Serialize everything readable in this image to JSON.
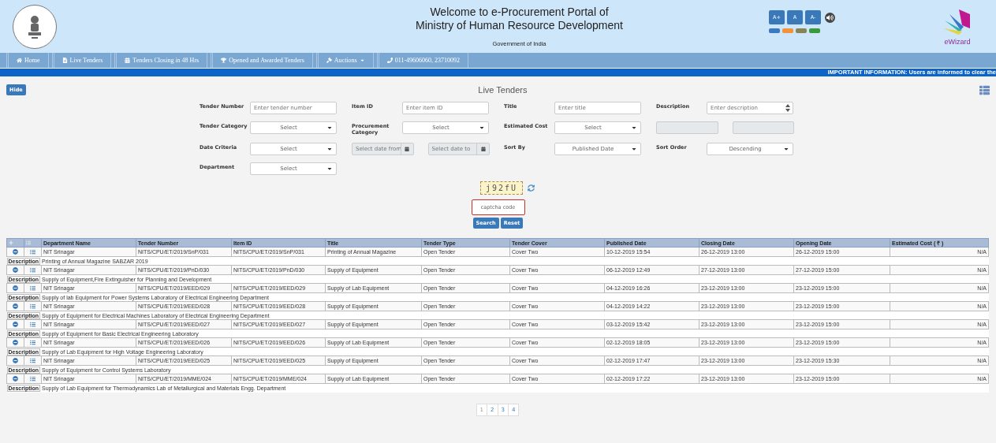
{
  "header": {
    "title_lines": [
      "Welcome to e-Procurement Portal of",
      "Ministry of Human Resource Development"
    ],
    "subtitle": "Government of India",
    "font_buttons": [
      "A+",
      "A",
      "A-"
    ],
    "theme_swatches": [
      {
        "color": "#3b7ac0"
      },
      {
        "color": "#f0933b"
      },
      {
        "color": "#878558"
      },
      {
        "color": "#3b9a3b"
      }
    ],
    "logo_text": "eWizard"
  },
  "nav": {
    "items": [
      {
        "label": "Home",
        "dropdown": false
      },
      {
        "label": "Live Tenders",
        "dropdown": false
      },
      {
        "label": "Tenders Closing in 48 Hrs",
        "dropdown": false
      },
      {
        "label": "Opened and Awarded Tenders",
        "dropdown": false
      },
      {
        "label": "Auctions",
        "dropdown": true
      },
      {
        "label": "011-49606060, 23710092",
        "dropdown": false
      }
    ]
  },
  "ticker": "IMPORTANT INFORMATION: Users are informed to clear the",
  "hide_button": "Hide",
  "page_title": "Live Tenders",
  "filters": [
    [
      {
        "label": "Tender Number",
        "fields": [
          {
            "kind": "text",
            "placeholder": "Enter tender number"
          }
        ]
      },
      {
        "label": "Item ID",
        "fields": [
          {
            "kind": "text",
            "placeholder": "Enter item ID"
          }
        ]
      },
      {
        "label": "Title",
        "fields": [
          {
            "kind": "text",
            "placeholder": "Enter title"
          }
        ]
      },
      {
        "label": "Description",
        "fields": [
          {
            "kind": "spin",
            "placeholder": "Enter description"
          }
        ]
      }
    ],
    [
      {
        "label": "Tender Category",
        "fields": [
          {
            "kind": "select",
            "value": "Select"
          }
        ]
      },
      {
        "label": "Procurement Category",
        "fields": [
          {
            "kind": "select",
            "value": "Select"
          }
        ]
      },
      {
        "label": "Estimated Cost",
        "fields": [
          {
            "kind": "select",
            "value": "Select"
          }
        ]
      },
      {
        "fields": [
          {
            "kind": "blank"
          },
          {
            "kind": "blank"
          }
        ]
      }
    ],
    [
      {
        "label": "Date Criteria",
        "fields": [
          {
            "kind": "select",
            "value": "Select"
          }
        ]
      },
      {
        "fields": [
          {
            "kind": "date",
            "placeholder": "Select date from"
          },
          {
            "kind": "date",
            "placeholder": "Select date to"
          }
        ]
      },
      {
        "label": "Sort By",
        "fields": [
          {
            "kind": "select",
            "value": "Published Date"
          }
        ]
      },
      {
        "label": "Sort Order",
        "fields": [
          {
            "kind": "select",
            "value": "Descending"
          }
        ]
      }
    ],
    [
      {
        "label": "Department",
        "fields": [
          {
            "kind": "select",
            "value": "Select"
          }
        ]
      }
    ]
  ],
  "captcha": {
    "text": "j92fU",
    "placeholder": "captcha code"
  },
  "form_buttons": [
    "Search",
    "Reset"
  ],
  "table": {
    "columns": [
      "Department Name",
      "Tender Number",
      "Item ID",
      "Title",
      "Tender Type",
      "Tender Cover",
      "Published Date",
      "Closing Date",
      "Opening Date",
      "Estimated Cost ( ₹ )"
    ],
    "rows": [
      {
        "cells": [
          "NIT Srinagar",
          "NITS/CPU/ET/2019/SnP/031",
          "NITS/CPU/ET/2019/SnP/031",
          "Printing of Annual Magazine",
          "Open Tender",
          "Cover Two",
          "10-12-2019 15:54",
          "26-12-2019 13:00",
          "26-12-2019 15:00",
          "N/A"
        ],
        "description_label": "Description",
        "description": "Printing of Annual Magazine SABZAR 2019"
      },
      {
        "cells": [
          "NIT Srinagar",
          "NITS/CPU/ET/2019/PnD/030",
          "NITS/CPU/ET/2019/PnD/030",
          "Supply of Equipment",
          "Open Tender",
          "Cover Two",
          "06-12-2019 12:49",
          "27-12-2019 13:00",
          "27-12-2019 15:00",
          "N/A"
        ],
        "description_label": "Description",
        "description": "Supply of Equipment,Fire Extinguisher for Planning and Development"
      },
      {
        "cells": [
          "NIT Srinagar",
          "NITS/CPU/ET/2019/EED/029",
          "NITS/CPU/ET/2019/EED/029",
          "Supply of Lab Equipment",
          "Open Tender",
          "Cover Two",
          "04-12-2019 16:26",
          "23-12-2019 13:00",
          "23-12-2019 15:00",
          "N/A"
        ],
        "description_label": "Description",
        "description": "Supply of lab Equipment for Power Systems Laboratory of Electrical Engineering Department"
      },
      {
        "cells": [
          "NIT Srinagar",
          "NITS/CPU/ET/2019/EED/028",
          "NITS/CPU/ET/2019/EED/028",
          "Supply of Equipment",
          "Open Tender",
          "Cover Two",
          "04-12-2019 14:22",
          "23-12-2019 13:00",
          "23-12-2019 15:00",
          "N/A"
        ],
        "description_label": "Description",
        "description": "Supply of Equipment for Electrical Machines Laboratory of Electrical Engineering Department"
      },
      {
        "cells": [
          "NIT Srinagar",
          "NITS/CPU/ET/2019/EED/027",
          "NITS/CPU/ET/2019/EED/027",
          "Supply of Equipment",
          "Open Tender",
          "Cover Two",
          "03-12-2019 15:42",
          "23-12-2019 13:00",
          "23-12-2019 15:00",
          "N/A"
        ],
        "description_label": "Description",
        "description": "Supply of Equipment for Basic Electrical Engineering Laboratory"
      },
      {
        "cells": [
          "NIT Srinagar",
          "NITS/CPU/ET/2019/EED/026",
          "NITS/CPU/ET/2019/EED/026",
          "Supply of Lab Equipment",
          "Open Tender",
          "Cover Two",
          "02-12-2019 18:05",
          "23-12-2019 13:00",
          "23-12-2019 15:00",
          "N/A"
        ],
        "description_label": "Description",
        "description": "Supply of Lab Equipment for High Voltage Engineering Laboratory"
      },
      {
        "cells": [
          "NIT Srinagar",
          "NITS/CPU/ET/2019/EED/025",
          "NITS/CPU/ET/2019/EED/025",
          "Supply of Equipment",
          "Open Tender",
          "Cover Two",
          "02-12-2019 17:47",
          "23-12-2019 13:00",
          "23-12-2019 15:30",
          "N/A"
        ],
        "description_label": "Description",
        "description": "Supply of Equipment for Control Systems Laboratory"
      },
      {
        "cells": [
          "NIT Srinagar",
          "NITS/CPU/ET/2019/MME/024",
          "NITS/CPU/ET/2019/MME/024",
          "Supply of Lab Equipment",
          "Open Tender",
          "Cover Two",
          "02-12-2019 17:22",
          "23-12-2019 13:00",
          "23-12-2019 15:00",
          "N/A"
        ],
        "description_label": "Description",
        "description": "Supply of Lab Equipment for Thermodynamics Lab of Metallurgical and Materials Engg. Department"
      }
    ]
  },
  "pagination": [
    {
      "label": "1",
      "selected": true
    },
    {
      "label": "2",
      "selected": false
    },
    {
      "label": "3",
      "selected": false
    },
    {
      "label": "4",
      "selected": false
    }
  ]
}
